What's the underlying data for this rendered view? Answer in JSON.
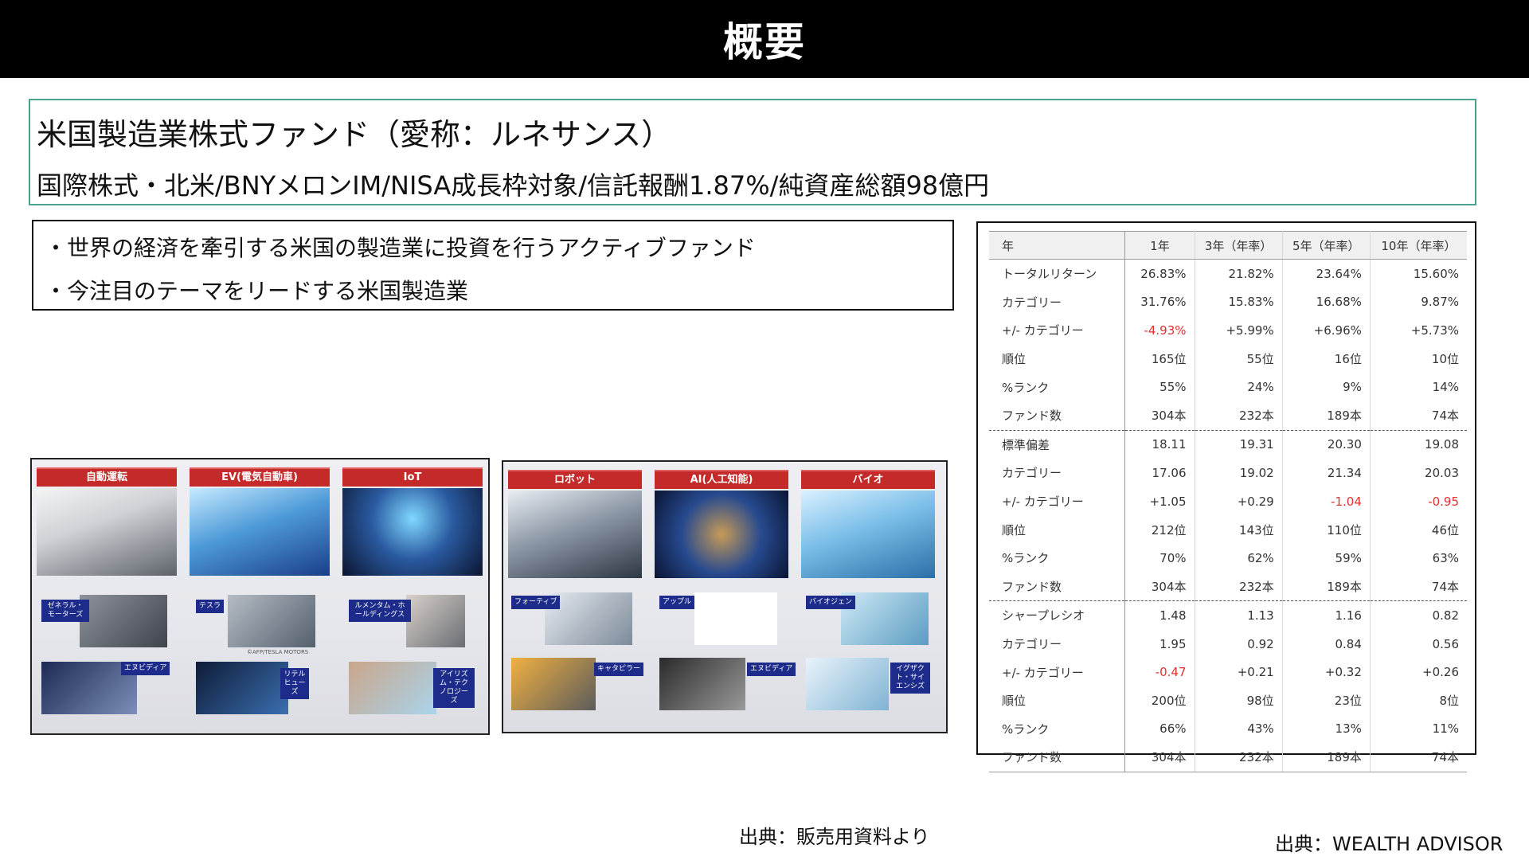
{
  "header": {
    "title": "概要"
  },
  "fund": {
    "name": "米国製造業株式ファンド（愛称：ルネサンス）",
    "details": "国際株式・北米/BNYメロンIM/NISA成長枠対象/信託報酬1.87%/純資産総額98億円"
  },
  "bullets": [
    "・世界の経済を牽引する米国の製造業に投資を行うアクティブファンド",
    "・今注目のテーマをリードする米国製造業"
  ],
  "themes_left": {
    "headers": [
      "自動運転",
      "EV(電気自動車)",
      "IoT"
    ],
    "tags": [
      "ゼネラル・モーターズ",
      "エヌビディア",
      "テスラ",
      "リテル ヒューズ",
      "ルメンタム・ホールディングス",
      "アイリズム・テクノロジーズ"
    ],
    "caption": "©AFP/TESLA MOTORS"
  },
  "themes_right": {
    "headers": [
      "ロボット",
      "AI(人工知能)",
      "バイオ"
    ],
    "tags": [
      "フォーティブ",
      "キャタピラー",
      "アップル",
      "エヌビディア",
      "バイオジェン",
      "イグザクト・サイエンシズ"
    ]
  },
  "stats": {
    "columns": [
      "年",
      "1年",
      "3年（年率）",
      "5年（年率）",
      "10年（年率）"
    ],
    "rows": [
      [
        "トータルリターン",
        "26.83%",
        "21.82%",
        "23.64%",
        "15.60%"
      ],
      [
        "カテゴリー",
        "31.76%",
        "15.83%",
        "16.68%",
        "9.87%"
      ],
      [
        "+/- カテゴリー",
        "-4.93%",
        "+5.99%",
        "+6.96%",
        "+5.73%"
      ],
      [
        "順位",
        "165位",
        "55位",
        "16位",
        "10位"
      ],
      [
        "%ランク",
        "55%",
        "24%",
        "9%",
        "14%"
      ],
      [
        "ファンド数",
        "304本",
        "232本",
        "189本",
        "74本"
      ],
      [
        "標準偏差",
        "18.11",
        "19.31",
        "20.30",
        "19.08"
      ],
      [
        "カテゴリー",
        "17.06",
        "19.02",
        "21.34",
        "20.03"
      ],
      [
        "+/- カテゴリー",
        "+1.05",
        "+0.29",
        "-1.04",
        "-0.95"
      ],
      [
        "順位",
        "212位",
        "143位",
        "110位",
        "46位"
      ],
      [
        "%ランク",
        "70%",
        "62%",
        "59%",
        "63%"
      ],
      [
        "ファンド数",
        "304本",
        "232本",
        "189本",
        "74本"
      ],
      [
        "シャープレシオ",
        "1.48",
        "1.13",
        "1.16",
        "0.82"
      ],
      [
        "カテゴリー",
        "1.95",
        "0.92",
        "0.84",
        "0.56"
      ],
      [
        "+/- カテゴリー",
        "-0.47",
        "+0.21",
        "+0.32",
        "+0.26"
      ],
      [
        "順位",
        "200位",
        "98位",
        "23位",
        "8位"
      ],
      [
        "%ランク",
        "66%",
        "43%",
        "13%",
        "11%"
      ],
      [
        "ファンド数",
        "304本",
        "232本",
        "189本",
        "74本"
      ]
    ],
    "negative_color": "#e03030"
  },
  "sources": {
    "left": "出典：販売用資料より",
    "right": "出典：WEALTH ADVISOR"
  },
  "colors": {
    "accent_border": "#4aa38e",
    "theme_header": "#c42a2a",
    "tag_bg": "#1d2c8a"
  }
}
